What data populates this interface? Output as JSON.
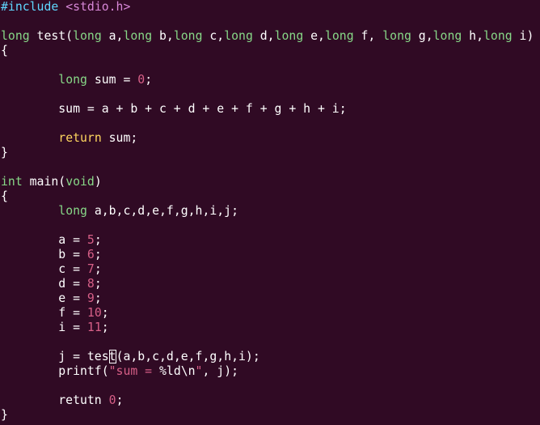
{
  "colors": {
    "background": "#300a24",
    "plain": "#ffffff",
    "preprocessor": "#5fd7ff",
    "include_path": "#d787d7",
    "type": "#87d787",
    "keyword": "#ffd75f",
    "number": "#d75f87"
  },
  "lines": [
    [
      {
        "t": "#include",
        "k": "pre"
      },
      {
        "t": " <stdio.h>",
        "k": "inc"
      }
    ],
    [],
    [
      {
        "t": "long",
        "k": "ty"
      },
      {
        "t": " test(",
        "k": "pl"
      },
      {
        "t": "long",
        "k": "ty"
      },
      {
        "t": " a,",
        "k": "pl"
      },
      {
        "t": "long",
        "k": "ty"
      },
      {
        "t": " b,",
        "k": "pl"
      },
      {
        "t": "long",
        "k": "ty"
      },
      {
        "t": " c,",
        "k": "pl"
      },
      {
        "t": "long",
        "k": "ty"
      },
      {
        "t": " d,",
        "k": "pl"
      },
      {
        "t": "long",
        "k": "ty"
      },
      {
        "t": " e,",
        "k": "pl"
      },
      {
        "t": "long",
        "k": "ty"
      },
      {
        "t": " f, ",
        "k": "pl"
      },
      {
        "t": "long",
        "k": "ty"
      },
      {
        "t": " g,",
        "k": "pl"
      },
      {
        "t": "long",
        "k": "ty"
      },
      {
        "t": " h,",
        "k": "pl"
      },
      {
        "t": "long",
        "k": "ty"
      },
      {
        "t": " i)",
        "k": "pl"
      }
    ],
    [
      {
        "t": "{",
        "k": "pl"
      }
    ],
    [],
    [
      {
        "t": "        ",
        "k": "pl"
      },
      {
        "t": "long",
        "k": "ty"
      },
      {
        "t": " sum = ",
        "k": "pl"
      },
      {
        "t": "0",
        "k": "num"
      },
      {
        "t": ";",
        "k": "pl"
      }
    ],
    [],
    [
      {
        "t": "        sum = a + b + c + d + e + f + g + h + i;",
        "k": "pl"
      }
    ],
    [],
    [
      {
        "t": "        ",
        "k": "pl"
      },
      {
        "t": "return",
        "k": "kw"
      },
      {
        "t": " sum;",
        "k": "pl"
      }
    ],
    [
      {
        "t": "}",
        "k": "pl"
      }
    ],
    [],
    [
      {
        "t": "int",
        "k": "ty"
      },
      {
        "t": " main(",
        "k": "pl"
      },
      {
        "t": "void",
        "k": "ty"
      },
      {
        "t": ")",
        "k": "pl"
      }
    ],
    [
      {
        "t": "{",
        "k": "pl"
      }
    ],
    [
      {
        "t": "        ",
        "k": "pl"
      },
      {
        "t": "long",
        "k": "ty"
      },
      {
        "t": " a,b,c,d,e,f,g,h,i,j;",
        "k": "pl"
      }
    ],
    [],
    [
      {
        "t": "        a = ",
        "k": "pl"
      },
      {
        "t": "5",
        "k": "num"
      },
      {
        "t": ";",
        "k": "pl"
      }
    ],
    [
      {
        "t": "        b = ",
        "k": "pl"
      },
      {
        "t": "6",
        "k": "num"
      },
      {
        "t": ";",
        "k": "pl"
      }
    ],
    [
      {
        "t": "        c = ",
        "k": "pl"
      },
      {
        "t": "7",
        "k": "num"
      },
      {
        "t": ";",
        "k": "pl"
      }
    ],
    [
      {
        "t": "        d = ",
        "k": "pl"
      },
      {
        "t": "8",
        "k": "num"
      },
      {
        "t": ";",
        "k": "pl"
      }
    ],
    [
      {
        "t": "        e = ",
        "k": "pl"
      },
      {
        "t": "9",
        "k": "num"
      },
      {
        "t": ";",
        "k": "pl"
      }
    ],
    [
      {
        "t": "        f = ",
        "k": "pl"
      },
      {
        "t": "10",
        "k": "num"
      },
      {
        "t": ";",
        "k": "pl"
      }
    ],
    [
      {
        "t": "        i = ",
        "k": "pl"
      },
      {
        "t": "11",
        "k": "num"
      },
      {
        "t": ";",
        "k": "pl"
      }
    ],
    [],
    [
      {
        "t": "        j = tes",
        "k": "pl"
      },
      {
        "t": "t",
        "k": "pl",
        "cursor": true
      },
      {
        "t": "(a,b,c,d,e,f,g,h,i);",
        "k": "pl"
      }
    ],
    [
      {
        "t": "        printf(",
        "k": "pl"
      },
      {
        "t": "\"sum = ",
        "k": "str"
      },
      {
        "t": "%ld\\n",
        "k": "pl"
      },
      {
        "t": "\"",
        "k": "str"
      },
      {
        "t": ", j);",
        "k": "pl"
      }
    ],
    [],
    [
      {
        "t": "        retutn ",
        "k": "pl"
      },
      {
        "t": "0",
        "k": "num"
      },
      {
        "t": ";",
        "k": "pl"
      }
    ],
    [
      {
        "t": "}",
        "k": "pl"
      }
    ]
  ]
}
